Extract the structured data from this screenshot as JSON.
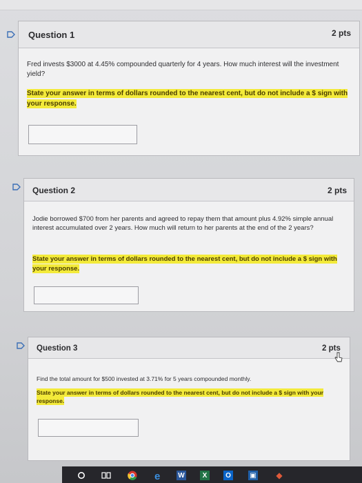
{
  "questions": [
    {
      "title": "Question 1",
      "points": "2 pts",
      "prompt": "Fred invests $3000 at 4.45% compounded quarterly for 4 years. How much interest will the investment yield?",
      "instruction": "State your answer in terms of dollars rounded to the nearest cent, but do not include a $ sign with your response.",
      "answer_value": ""
    },
    {
      "title": "Question 2",
      "points": "2 pts",
      "prompt": "Jodie borrowed $700 from her parents and agreed to repay them that amount plus 4.92% simple annual interest accumulated over 2 years. How much will return to her parents at the end of the 2 years?",
      "instruction": "State your answer in terms of dollars rounded to the nearest cent, but do not include a $ sign with your response.",
      "answer_value": ""
    },
    {
      "title": "Question 3",
      "points": "2 pts",
      "prompt": "Find the total amount for $500 invested at 3.71% for 5 years compounded monthly.",
      "instruction": "State your answer in terms of dollars rounded to the nearest cent, but do not include a $ sign with your response.",
      "answer_value": ""
    }
  ],
  "taskbar": {
    "icons": [
      "search-icon",
      "task-view-icon",
      "chrome-icon",
      "edge-icon",
      "word-icon",
      "excel-icon",
      "outlook-icon",
      "store-icon",
      "app-icon"
    ]
  },
  "colors": {
    "highlight": "#f3ea3a",
    "flag_blue": "#3b6fb6"
  }
}
